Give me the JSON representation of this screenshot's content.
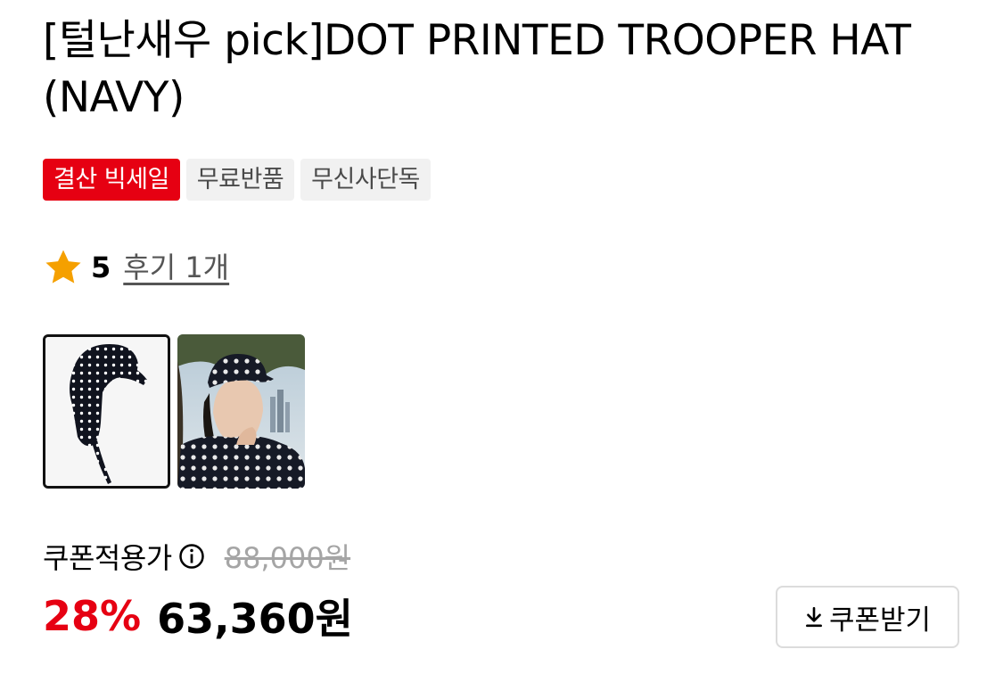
{
  "product": {
    "title": "[털난새우 pick]DOT PRINTED TROOPER HAT (NAVY)",
    "badges": [
      {
        "label": "결산 빅세일",
        "style": "sale",
        "color": "#e60012"
      },
      {
        "label": "무료반품",
        "style": "plain"
      },
      {
        "label": "무신사단독",
        "style": "plain"
      }
    ]
  },
  "rating": {
    "icon": "star-icon",
    "star_color": "#f5a000",
    "score": "5",
    "review_label": "후기 1개"
  },
  "gallery": {
    "thumbnails": [
      {
        "name": "hat-product-image",
        "selected": true
      },
      {
        "name": "model-wearing-hat-image",
        "selected": false
      }
    ]
  },
  "price": {
    "coupon_price_label": "쿠폰적용가",
    "info_icon": "info-icon",
    "original_price": "88,000원",
    "discount_rate": "28%",
    "final_price": "63,360원",
    "accent_color": "#e60012"
  },
  "coupon_button": {
    "icon": "download-icon",
    "label": "쿠폰받기"
  }
}
